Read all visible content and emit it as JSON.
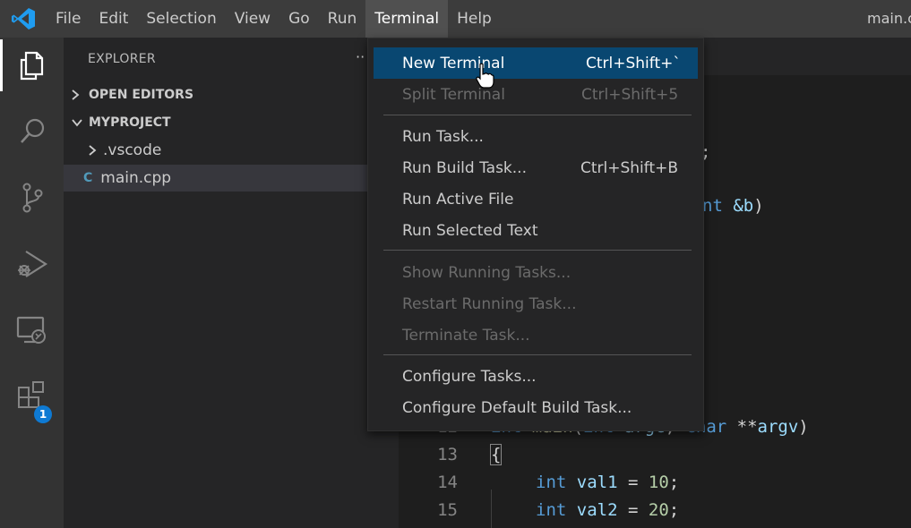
{
  "menubar": {
    "items": [
      "File",
      "Edit",
      "Selection",
      "View",
      "Go",
      "Run",
      "Terminal",
      "Help"
    ],
    "active": "Terminal",
    "window_title": "main.c"
  },
  "activitybar": {
    "icons": [
      "explorer-icon",
      "search-icon",
      "source-control-icon",
      "run-debug-icon",
      "remote-explorer-icon",
      "extensions-icon"
    ],
    "extensions_badge": "1"
  },
  "sidebar": {
    "title": "EXPLORER",
    "more": "··",
    "open_editors": "OPEN EDITORS",
    "project": "MYPROJECT",
    "folder": ".vscode",
    "file": "main.cpp",
    "file_icon_glyph": "C"
  },
  "editor": {
    "visible_fragments": [
      ";",
      "nt &b)"
    ],
    "lines": [
      {
        "number": "12",
        "text": "int main(int argc, char **argv)"
      },
      {
        "number": "13",
        "text": "{"
      },
      {
        "number": "14",
        "text": "int val1 = 10;"
      },
      {
        "number": "15",
        "text": "int val2 = 20;"
      }
    ],
    "partial_line_12": {
      "rest": "char **argv)"
    }
  },
  "terminal_menu": {
    "items": [
      {
        "label": "New Terminal",
        "shortcut": "Ctrl+Shift+`",
        "state": "highlighted"
      },
      {
        "label": "Split Terminal",
        "shortcut": "Ctrl+Shift+5",
        "state": "disabled"
      },
      {
        "label": "Run Task...",
        "shortcut": "",
        "state": "enabled"
      },
      {
        "label": "Run Build Task...",
        "shortcut": "Ctrl+Shift+B",
        "state": "enabled"
      },
      {
        "label": "Run Active File",
        "shortcut": "",
        "state": "enabled"
      },
      {
        "label": "Run Selected Text",
        "shortcut": "",
        "state": "enabled"
      },
      {
        "label": "Show Running Tasks...",
        "shortcut": "",
        "state": "disabled"
      },
      {
        "label": "Restart Running Task...",
        "shortcut": "",
        "state": "disabled"
      },
      {
        "label": "Terminate Task...",
        "shortcut": "",
        "state": "disabled"
      },
      {
        "label": "Configure Tasks...",
        "shortcut": "",
        "state": "enabled"
      },
      {
        "label": "Configure Default Build Task...",
        "shortcut": "",
        "state": "enabled"
      }
    ]
  },
  "colors": {
    "accent": "#094771",
    "badge": "#0e7ad3",
    "keyword": "#569cd6",
    "identifier": "#9cdcfe",
    "number": "#b5cea8"
  }
}
